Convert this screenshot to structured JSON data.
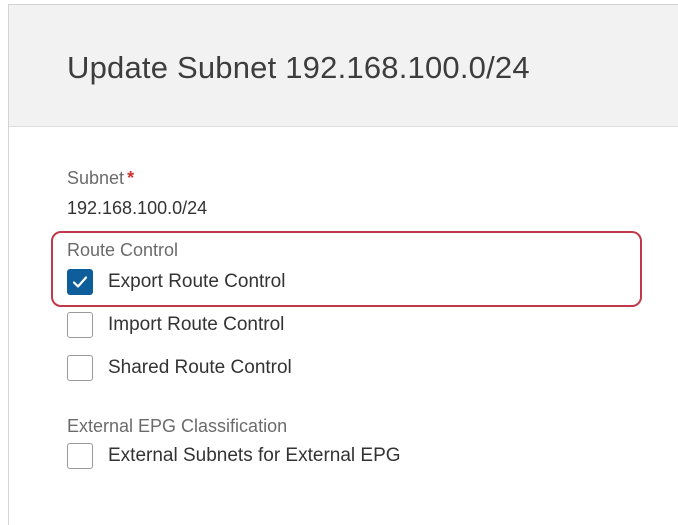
{
  "dialog": {
    "title": "Update Subnet 192.168.100.0/24"
  },
  "subnet": {
    "label": "Subnet",
    "required_marker": "*",
    "value": "192.168.100.0/24"
  },
  "route_control": {
    "label": "Route Control",
    "options": [
      {
        "label": "Export Route Control",
        "checked": true
      },
      {
        "label": "Import Route Control",
        "checked": false
      },
      {
        "label": "Shared Route Control",
        "checked": false
      }
    ]
  },
  "external_epg": {
    "label": "External EPG Classification",
    "options": [
      {
        "label": "External Subnets for External EPG",
        "checked": false
      }
    ]
  },
  "colors": {
    "checkbox_checked": "#0d5e9a",
    "highlight_border": "#c0394a",
    "required_star": "#d0312d",
    "header_background": "#f2f2f2"
  },
  "icons": {
    "checked": "checkmark-icon"
  }
}
